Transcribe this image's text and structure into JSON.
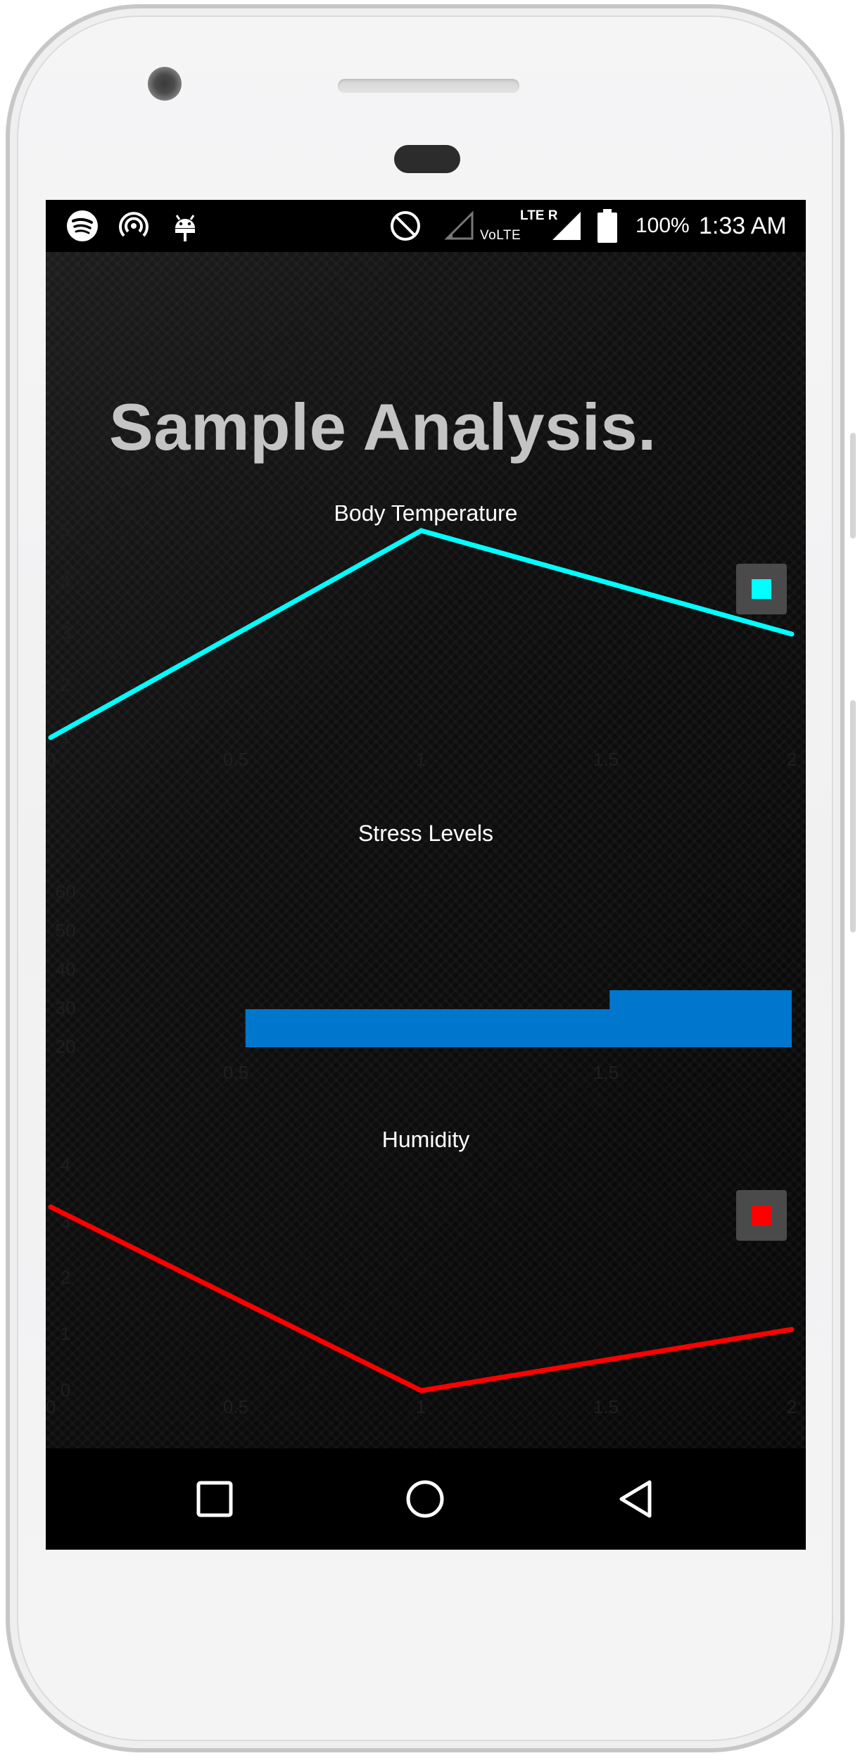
{
  "status_bar": {
    "icons_left": [
      "spotify-icon",
      "hotspot-icon",
      "android-debug-icon"
    ],
    "icons_right": [
      "do-not-disturb-icon",
      "signal-empty-icon",
      "volte-icon",
      "lte-roaming-icon",
      "signal-full-icon",
      "battery-icon"
    ],
    "volte_label": "VoLTE",
    "lte_label": "LTE R",
    "battery": "100%",
    "time": "1:33 AM"
  },
  "page": {
    "title": "Sample Analysis."
  },
  "colors": {
    "body_temperature": "#00ffff",
    "stress_levels": "#0077cc",
    "humidity": "#ff0000",
    "legend_bg": "#4a4a4a"
  },
  "chart_data": [
    {
      "type": "line",
      "title": "Body Temperature",
      "x": [
        0,
        1,
        2
      ],
      "xlim": [
        0,
        2
      ],
      "ylim": [
        1,
        5
      ],
      "x_ticks": [
        "0",
        "0.5",
        "1",
        "1.5",
        "2"
      ],
      "y_ticks": [
        "1",
        "2",
        "3",
        "4",
        "5"
      ],
      "series": [
        {
          "values": [
            1,
            5,
            3
          ],
          "color": "#00ffff"
        }
      ],
      "legend": "top-right",
      "grid": false
    },
    {
      "type": "area",
      "title": "Stress Levels",
      "x": [
        0,
        0.5,
        1,
        1.5,
        2
      ],
      "xlim": [
        0,
        2
      ],
      "ylim": [
        20,
        60
      ],
      "x_ticks": [
        "0.5",
        "1.5"
      ],
      "y_ticks": [
        "20",
        "30",
        "40",
        "50",
        "60"
      ],
      "series": [
        {
          "values": [
            20,
            28,
            28,
            32,
            32
          ],
          "step": true,
          "color": "#0077cc"
        }
      ],
      "grid": false
    },
    {
      "type": "line",
      "title": "Humidity",
      "x": [
        0,
        1,
        2
      ],
      "xlim": [
        0,
        2
      ],
      "ylim": [
        0,
        4
      ],
      "x_ticks": [
        "0",
        "0.5",
        "1",
        "1.5",
        "2"
      ],
      "y_ticks": [
        "0",
        "1",
        "2",
        "3",
        "4"
      ],
      "series": [
        {
          "values": [
            3,
            0,
            1
          ],
          "color": "#ff0000"
        }
      ],
      "legend": "top-right",
      "grid": false
    }
  ],
  "nav": {
    "recents": "recents-button",
    "home": "home-button",
    "back": "back-button"
  }
}
